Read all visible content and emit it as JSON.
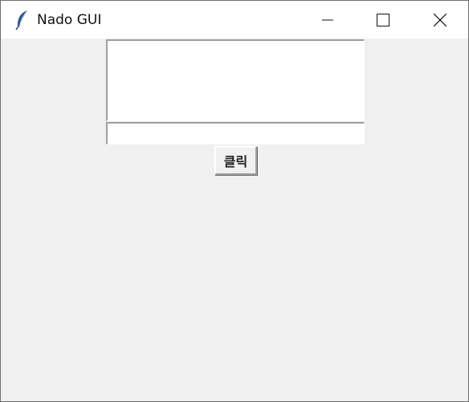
{
  "window": {
    "title": "Nado GUI",
    "icon": "feather-icon",
    "controls": {
      "minimize": "minimize-icon",
      "maximize": "maximize-icon",
      "close": "close-icon"
    }
  },
  "main": {
    "textbox_value": "",
    "entry_value": "",
    "button_label": "클릭"
  }
}
